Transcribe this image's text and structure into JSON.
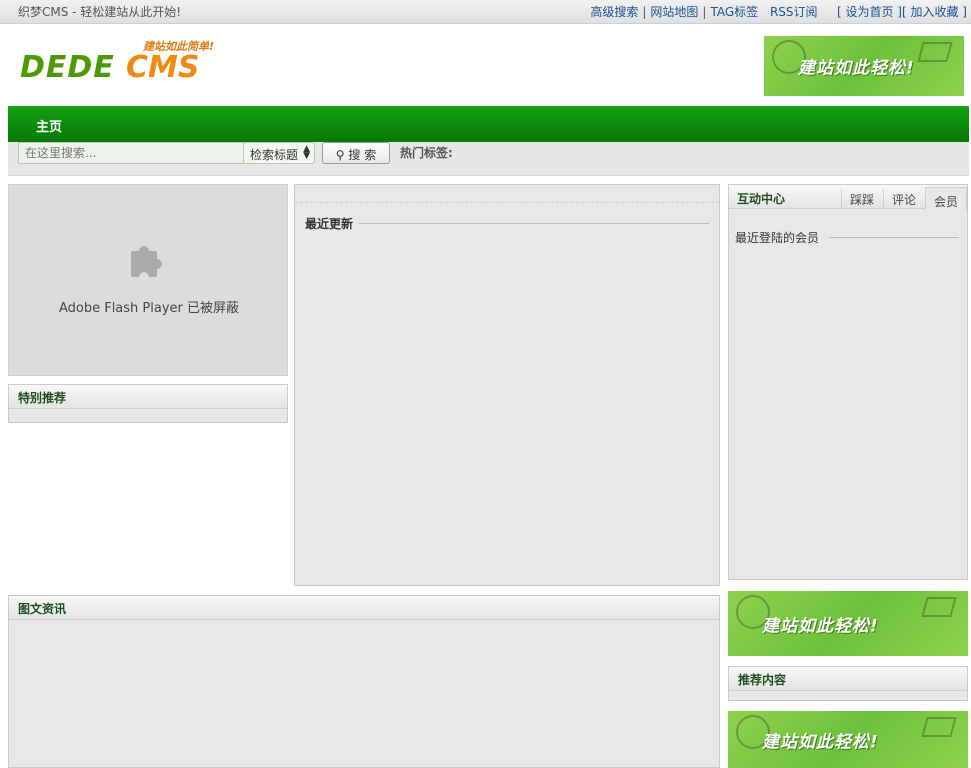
{
  "topbar": {
    "welcome": "织梦CMS - 轻松建站从此开始!",
    "links": [
      "高级搜索",
      "网站地图",
      "TAG标签",
      "RSS订阅"
    ],
    "set_home": "[ 设为首页 ]",
    "add_fav": "[ 加入收藏 ]"
  },
  "logo": {
    "slogan": "建站如此简单!",
    "text_left": "DEDE",
    "text_right": "CMS"
  },
  "banner_text": "建站如此轻松!",
  "nav": {
    "home": "主页"
  },
  "search": {
    "placeholder": "在这里搜索...",
    "type_selected": "检索标题",
    "button": "搜 索",
    "hot_tags_label": "热门标签:"
  },
  "flash": {
    "message": "Adobe Flash Player 已被屏蔽"
  },
  "panels": {
    "special": "特别推荐",
    "latest": "最近更新",
    "pic_news": "图文资讯",
    "recommend": "推荐内容"
  },
  "interaction": {
    "title": "互动中心",
    "tabs": [
      "踩踩",
      "评论",
      "会员"
    ],
    "active_tab": 2,
    "recent_members": "最近登陆的会员"
  },
  "colors": {
    "nav_green": "#067806",
    "logo_green": "#4e9a06",
    "logo_orange": "#f08a10",
    "link_blue": "#1c4f8f"
  }
}
